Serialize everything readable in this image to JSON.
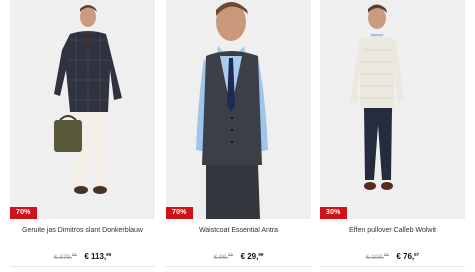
{
  "products": [
    {
      "badge": "70%",
      "name": "Geruite jas Dimitros slant Donkerblauw",
      "old_price_main": "€ 379,",
      "old_price_cents": "95",
      "new_price_main": "€ 113,",
      "new_price_cents": "99",
      "image": "model-checked-coat-with-bag"
    },
    {
      "badge": "70%",
      "name": "Waistcoat Essential Antra",
      "old_price_main": "€ 99,",
      "old_price_cents": "95",
      "new_price_main": "€ 29,",
      "new_price_cents": "99",
      "image": "model-waistcoat-blue-shirt"
    },
    {
      "badge": "30%",
      "name": "Effen pullover Calleb Wolwit",
      "old_price_main": "€ 109,",
      "old_price_cents": "95",
      "new_price_main": "€ 76,",
      "new_price_cents": "97",
      "image": "model-white-pullover"
    }
  ],
  "colors": {
    "badge_bg": "#d0131b",
    "photo_bg": "#efefef"
  }
}
